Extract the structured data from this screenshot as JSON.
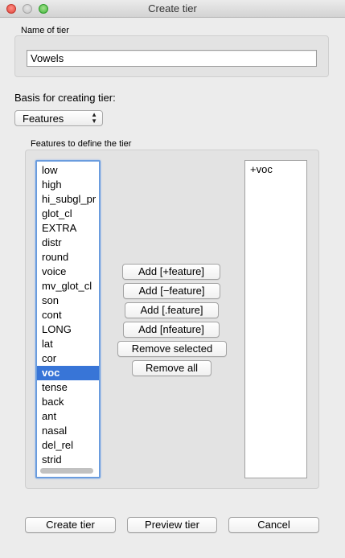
{
  "window": {
    "title": "Create tier"
  },
  "name_section": {
    "label": "Name of tier",
    "value": "Vowels"
  },
  "basis": {
    "label": "Basis for creating tier:",
    "selected": "Features"
  },
  "features_section": {
    "label": "Features to define the tier",
    "features": [
      "low",
      "high",
      "hi_subgl_pr",
      "glot_cl",
      "EXTRA",
      "distr",
      "round",
      "voice",
      "mv_glot_cl",
      "son",
      "cont",
      "LONG",
      "lat",
      "cor",
      "voc",
      "tense",
      "back",
      "ant",
      "nasal",
      "del_rel",
      "strid"
    ],
    "selected_feature": "voc",
    "selected_list": [
      "+voc"
    ]
  },
  "buttons": {
    "add_plus": "Add [+feature]",
    "add_minus": "Add [−feature]",
    "add_dot": "Add [.feature]",
    "add_n": "Add [nfeature]",
    "remove_selected": "Remove selected",
    "remove_all": "Remove all"
  },
  "footer": {
    "create": "Create tier",
    "preview": "Preview tier",
    "cancel": "Cancel"
  },
  "colors": {
    "selection": "#3875d7",
    "focus_ring": "#6a9cde",
    "close": "#e0443a",
    "maximize": "#3fb43a"
  }
}
